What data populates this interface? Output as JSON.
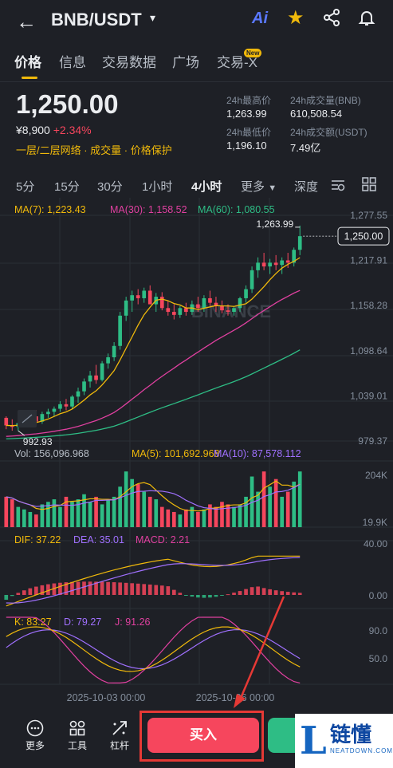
{
  "header": {
    "back": "←",
    "pair": "BNB/USDT",
    "caret": "▾",
    "ai": "Ai"
  },
  "tabs": [
    {
      "label": "价格"
    },
    {
      "label": "信息"
    },
    {
      "label": "交易数据"
    },
    {
      "label": "广场"
    },
    {
      "label": "交易-X"
    }
  ],
  "new_badge": "New",
  "price": {
    "last": "1,250.00",
    "cny": "¥8,900",
    "change": "+2.34%",
    "features": "一层/二层网络 · 成交量 · 价格保护"
  },
  "stats": {
    "high_label": "24h最高价",
    "high": "1,263.99",
    "vol_bnb_label": "24h成交量(BNB)",
    "vol_bnb": "610,508.54",
    "low_label": "24h最低价",
    "low": "1,196.10",
    "vol_usdt_label": "24h成交额(USDT)",
    "vol_usdt": "7.49亿"
  },
  "intervals": [
    "5分",
    "15分",
    "30分",
    "1小时",
    "4小时",
    "更多",
    "深度"
  ],
  "colors": {
    "up": "#2ebd85",
    "down": "#f6465d",
    "ma7": "#f0b90b",
    "ma30": "#e040a0",
    "ma60": "#2ebd85",
    "accent": "#f0b90b",
    "bg": "#1e2026"
  },
  "chart_data": {
    "type": "candlestick",
    "ma_legend": {
      "ma7": "MA(7): 1,223.43",
      "ma30": "MA(30): 1,158.52",
      "ma60": "MA(60): 1,080.55"
    },
    "y_ticks": [
      "1,277.55",
      "1,217.91",
      "1,158.28",
      "1,098.64",
      "1,039.01",
      "979.37"
    ],
    "y_range": [
      979.37,
      1277.55
    ],
    "current_price_label": "1,250.00",
    "high_marker": "1,263.99",
    "low_marker": "992.93",
    "watermark": "BINANCE",
    "x_labels": [
      "2025-10-03 00:00",
      "2025-10-06 00:00"
    ],
    "candles_ohlc": [
      [
        1010,
        1012,
        995,
        1000
      ],
      [
        1000,
        1008,
        993,
        998
      ],
      [
        998,
        1005,
        992.93,
        1003
      ],
      [
        1003,
        1012,
        1000,
        1008
      ],
      [
        1008,
        1016,
        1003,
        1012
      ],
      [
        1012,
        1020,
        1008,
        1005
      ],
      [
        1005,
        1018,
        1002,
        1015
      ],
      [
        1015,
        1022,
        1010,
        1018
      ],
      [
        1018,
        1025,
        1012,
        1022
      ],
      [
        1022,
        1032,
        1018,
        1028
      ],
      [
        1028,
        1035,
        1020,
        1025
      ],
      [
        1025,
        1040,
        1022,
        1038
      ],
      [
        1038,
        1050,
        1030,
        1045
      ],
      [
        1045,
        1062,
        1040,
        1058
      ],
      [
        1058,
        1072,
        1050,
        1066
      ],
      [
        1066,
        1080,
        1055,
        1060
      ],
      [
        1060,
        1085,
        1058,
        1082
      ],
      [
        1082,
        1095,
        1075,
        1090
      ],
      [
        1090,
        1110,
        1085,
        1105
      ],
      [
        1105,
        1150,
        1100,
        1145
      ],
      [
        1145,
        1170,
        1138,
        1165
      ],
      [
        1165,
        1178,
        1150,
        1172
      ],
      [
        1172,
        1180,
        1160,
        1168
      ],
      [
        1168,
        1182,
        1162,
        1178
      ],
      [
        1178,
        1185,
        1165,
        1160
      ],
      [
        1160,
        1175,
        1150,
        1170
      ],
      [
        1170,
        1176,
        1152,
        1155
      ],
      [
        1155,
        1165,
        1145,
        1150
      ],
      [
        1150,
        1160,
        1140,
        1146
      ],
      [
        1146,
        1158,
        1142,
        1155
      ],
      [
        1155,
        1162,
        1145,
        1150
      ],
      [
        1150,
        1165,
        1146,
        1160
      ],
      [
        1160,
        1170,
        1150,
        1155
      ],
      [
        1155,
        1172,
        1150,
        1168
      ],
      [
        1168,
        1178,
        1158,
        1162
      ],
      [
        1162,
        1170,
        1150,
        1158
      ],
      [
        1158,
        1165,
        1148,
        1152
      ],
      [
        1152,
        1160,
        1145,
        1150
      ],
      [
        1150,
        1158,
        1145,
        1155
      ],
      [
        1155,
        1170,
        1150,
        1168
      ],
      [
        1168,
        1185,
        1162,
        1180
      ],
      [
        1180,
        1210,
        1175,
        1205
      ],
      [
        1205,
        1222,
        1195,
        1215
      ],
      [
        1215,
        1228,
        1205,
        1210
      ],
      [
        1210,
        1220,
        1200,
        1215
      ],
      [
        1215,
        1225,
        1205,
        1212
      ],
      [
        1212,
        1222,
        1200,
        1218
      ],
      [
        1218,
        1228,
        1208,
        1215
      ],
      [
        1215,
        1235,
        1210,
        1232
      ],
      [
        1232,
        1263.99,
        1225,
        1250
      ]
    ],
    "volume": {
      "legend": {
        "vol": "Vol: 156,096.968",
        "ma5": "MA(5): 101,692.968",
        "ma10": "MA(10): 87,578.112"
      },
      "y_ticks": [
        "204K",
        "19.9K"
      ],
      "values": [
        60,
        55,
        40,
        35,
        30,
        25,
        45,
        50,
        55,
        40,
        60,
        50,
        55,
        65,
        50,
        60,
        45,
        55,
        60,
        80,
        110,
        95,
        85,
        70,
        60,
        55,
        40,
        35,
        30,
        25,
        35,
        40,
        30,
        35,
        45,
        40,
        50,
        45,
        40,
        45,
        60,
        100,
        70,
        110,
        80,
        95,
        60,
        70,
        90,
        110
      ]
    },
    "macd": {
      "legend": {
        "dif": "DIF: 37.22",
        "dea": "DEA: 35.01",
        "macd": "MACD: 2.21"
      },
      "y_ticks": [
        "40.00",
        "0.00"
      ]
    },
    "kdj": {
      "legend": {
        "k": "K: 83.27",
        "d": "D: 79.27",
        "j": "J: 91.26"
      },
      "y_ticks": [
        "90.0",
        "50.0"
      ]
    }
  },
  "bottom": {
    "more": "更多",
    "tools": "工具",
    "leverage": "杠杆",
    "buy": "买入"
  },
  "logo": {
    "letter": "L",
    "cn": "链懂",
    "en": "NEATDOWN.COM"
  }
}
